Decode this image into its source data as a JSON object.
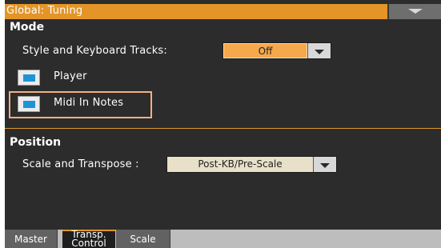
{
  "window": {
    "title": "Global: Tuning",
    "menu_icon": "chevron-down-icon"
  },
  "mode": {
    "title": "Mode",
    "style_keyboard_label": "Style and Keyboard Tracks:",
    "style_keyboard_value": "Off",
    "player_label": "Player",
    "player_checked": true,
    "midi_in_label": "Midi In Notes",
    "midi_in_checked": true
  },
  "position": {
    "title": "Position",
    "scale_transpose_label": "Scale and Transpose :",
    "scale_transpose_value": "Post-KB/Pre-Scale"
  },
  "tabs": [
    {
      "line1": "Master",
      "line2": "",
      "active": false
    },
    {
      "line1": "Transp.",
      "line2": "Control",
      "active": true
    },
    {
      "line1": "Scale",
      "line2": "",
      "active": false
    }
  ],
  "colors": {
    "accent_orange": "#e39528",
    "panel_bg": "#2c2c2c",
    "checkbox_blue": "#1e93d6",
    "highlight": "#f4b083"
  }
}
